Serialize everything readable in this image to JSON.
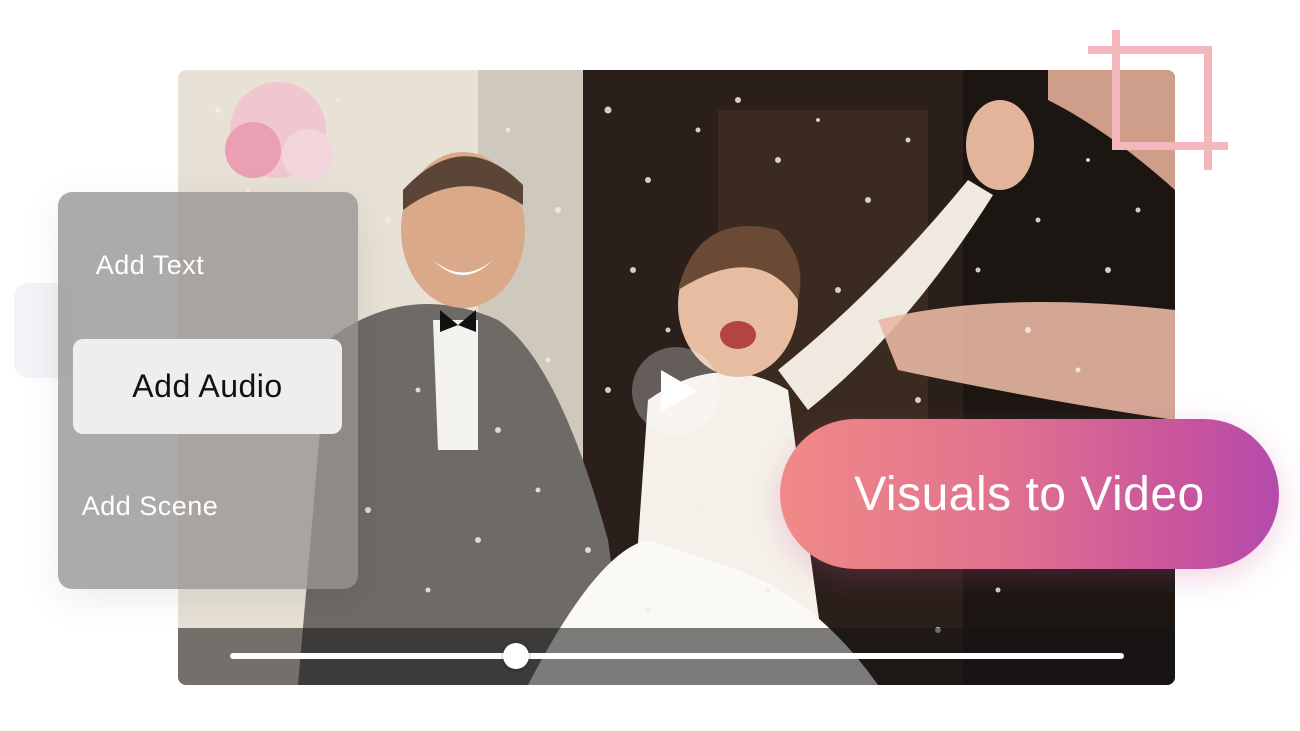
{
  "menu": {
    "items": [
      {
        "label": "Add Text"
      },
      {
        "label": "Add Audio",
        "selected": true
      },
      {
        "label": "Add Scene"
      }
    ]
  },
  "player": {
    "progress": 0.32
  },
  "cta": {
    "label": "Visuals to Video"
  },
  "colors": {
    "cta_gradient_start": "#f08a86",
    "cta_gradient_end": "#b54aad",
    "crop_icon": "#f3b7bd"
  },
  "icons": {
    "play": "play-icon",
    "crop": "crop-icon"
  }
}
